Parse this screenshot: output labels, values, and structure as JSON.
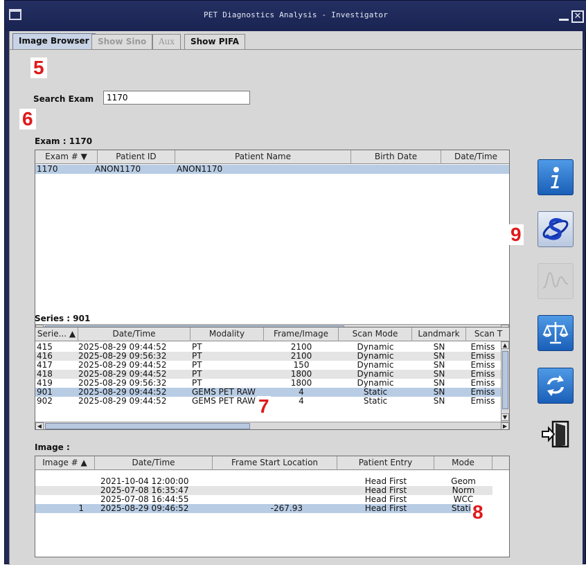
{
  "window": {
    "title": "PET  Diagnostics Analysis - Investigator"
  },
  "tabs": [
    {
      "label": "Image Browser",
      "state": "active"
    },
    {
      "label": "Show Sino",
      "state": "disabled"
    },
    {
      "label": "Aux",
      "state": "disabled"
    },
    {
      "label": "Show PIFA",
      "state": "normal"
    }
  ],
  "callouts": {
    "c5": "5",
    "c6": "6",
    "c7": "7",
    "c8": "8",
    "c9": "9"
  },
  "search": {
    "label": "Search Exam",
    "value": "1170"
  },
  "exam": {
    "label": "Exam :  1170",
    "columns": [
      "Exam # ▼",
      "Patient ID",
      "Patient Name",
      "Birth Date",
      "Date/Time"
    ],
    "rows": [
      [
        "1170",
        "ANON1170",
        "ANON1170",
        "",
        ""
      ]
    ]
  },
  "series": {
    "label": "Series :  901",
    "columns": [
      "Serie... ▲",
      "Date/Time",
      "Modality",
      "Frame/Image",
      "Scan Mode",
      "Landmark",
      "Scan T"
    ],
    "rows": [
      [
        "415",
        "2025-08-29  09:44:52",
        "PT",
        "2100",
        "Dynamic",
        "SN",
        "Emiss"
      ],
      [
        "416",
        "2025-08-29  09:56:32",
        "PT",
        "2100",
        "Dynamic",
        "SN",
        "Emiss"
      ],
      [
        "417",
        "2025-08-29  09:44:52",
        "PT",
        "150",
        "Dynamic",
        "SN",
        "Emiss"
      ],
      [
        "418",
        "2025-08-29  09:44:52",
        "PT",
        "1800",
        "Dynamic",
        "SN",
        "Emiss"
      ],
      [
        "419",
        "2025-08-29  09:56:32",
        "PT",
        "1800",
        "Dynamic",
        "SN",
        "Emiss"
      ],
      [
        "901",
        "2025-08-29  09:44:52",
        "GEMS PET RAW",
        "4",
        "Static",
        "SN",
        "Emiss"
      ],
      [
        "902",
        "2025-08-29  09:44:52",
        "GEMS PET RAW",
        "4",
        "Static",
        "SN",
        "Emiss"
      ]
    ]
  },
  "image": {
    "label": "Image :",
    "columns": [
      "Image # ▲",
      "Date/Time",
      "Frame Start Location",
      "Patient Entry",
      "Mode"
    ],
    "rows": [
      [
        "",
        "2021-10-04  12:00:00",
        "",
        "Head First",
        "Geom"
      ],
      [
        "",
        "2025-07-08  16:35:47",
        "",
        "Head First",
        "Norm"
      ],
      [
        "",
        "2025-07-08  16:44:55",
        "",
        "Head First",
        "WCC"
      ],
      [
        "1",
        "2025-08-29  09:46:52",
        "-267.93",
        "Head First",
        "Static"
      ]
    ]
  },
  "icons": [
    "info-icon",
    "sino-s-icon",
    "waveform-icon",
    "scales-icon",
    "refresh-icon",
    "exit-door-icon"
  ],
  "colors": {
    "selection": "#b8cce4",
    "callout": "#e0191b",
    "titlebar": "#202a55",
    "panel": "#d7d7d7"
  }
}
